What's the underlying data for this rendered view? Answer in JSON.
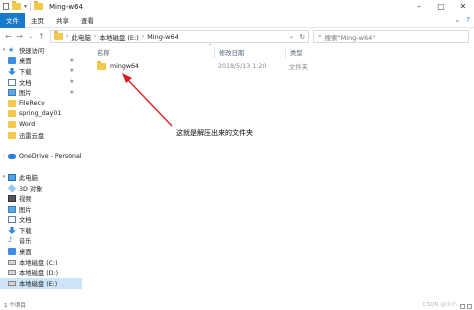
{
  "window": {
    "title": "Ming-w64"
  },
  "ribbon": {
    "tabs": [
      "文件",
      "主页",
      "共享",
      "查看"
    ]
  },
  "address": {
    "breadcrumbs": [
      "此电脑",
      "本地磁盘 (E:)",
      "Ming-w64"
    ],
    "search_placeholder": "搜索\"Ming-w64\""
  },
  "sidebar": {
    "items": [
      {
        "label": "快速访问",
        "icon": "star-icon",
        "pinned": false
      },
      {
        "label": "桌面",
        "icon": "desktop-icon",
        "pinned": true
      },
      {
        "label": "下载",
        "icon": "download-icon",
        "pinned": true
      },
      {
        "label": "文档",
        "icon": "document-icon",
        "pinned": true
      },
      {
        "label": "图片",
        "icon": "picture-icon",
        "pinned": true
      },
      {
        "label": "FileRecv",
        "icon": "folder-icon",
        "pinned": false
      },
      {
        "label": "spring_day01",
        "icon": "folder-icon",
        "pinned": false
      },
      {
        "label": "Word",
        "icon": "folder-icon",
        "pinned": false
      },
      {
        "label": "迅雷云盘",
        "icon": "folder-icon",
        "pinned": false
      },
      {
        "label": "",
        "icon": "",
        "pinned": false
      },
      {
        "label": "OneDrive - Personal",
        "icon": "cloud-icon",
        "pinned": false
      },
      {
        "label": "",
        "icon": "",
        "pinned": false
      },
      {
        "label": "此电脑",
        "icon": "computer-icon",
        "pinned": false
      },
      {
        "label": "3D 对象",
        "icon": "3d-objects-icon",
        "pinned": false
      },
      {
        "label": "视频",
        "icon": "video-icon",
        "pinned": false
      },
      {
        "label": "图片",
        "icon": "picture-icon",
        "pinned": false
      },
      {
        "label": "文档",
        "icon": "document-icon",
        "pinned": false
      },
      {
        "label": "下载",
        "icon": "download-icon",
        "pinned": false
      },
      {
        "label": "音乐",
        "icon": "music-icon",
        "pinned": false
      },
      {
        "label": "桌面",
        "icon": "desktop-icon",
        "pinned": false
      },
      {
        "label": "本地磁盘 (C:)",
        "icon": "drive-icon",
        "pinned": false
      },
      {
        "label": "本地磁盘 (D:)",
        "icon": "drive-icon",
        "pinned": false
      },
      {
        "label": "本地磁盘 (E:)",
        "icon": "drive-icon",
        "pinned": false,
        "selected": true
      }
    ]
  },
  "columns": {
    "name": "名称",
    "date": "修改日期",
    "type": "类型"
  },
  "files": [
    {
      "name": "mingw64",
      "date": "2018/5/13 1:20",
      "type": "文件夹"
    }
  ],
  "annotation": {
    "text": "这就是解压出来的文件夹"
  },
  "status": {
    "count": "1 个项目"
  },
  "watermark": "CSDN @小小...",
  "colors": {
    "accent": "#1979ca",
    "arrow": "#d81e1e",
    "folder": "#f2c94c"
  }
}
